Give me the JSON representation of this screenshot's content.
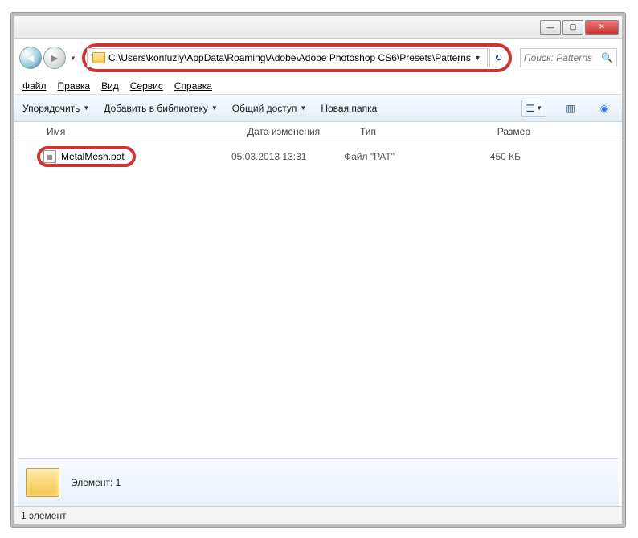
{
  "address": {
    "path": "C:\\Users\\konfuziy\\AppData\\Roaming\\Adobe\\Adobe Photoshop CS6\\Presets\\Patterns"
  },
  "search": {
    "placeholder": "Поиск: Patterns"
  },
  "menu": {
    "file": "Файл",
    "edit": "Правка",
    "view": "Вид",
    "tools": "Сервис",
    "help": "Справка"
  },
  "toolbar": {
    "organize": "Упорядочить",
    "addlib": "Добавить в библиотеку",
    "share": "Общий доступ",
    "newfolder": "Новая папка"
  },
  "columns": {
    "name": "Имя",
    "date": "Дата изменения",
    "type": "Тип",
    "size": "Размер"
  },
  "files": [
    {
      "name": "MetalMesh.pat",
      "date": "05.03.2013 13:31",
      "type": "Файл \"PAT\"",
      "size": "450 КБ"
    }
  ],
  "details": {
    "label": "Элемент: 1"
  },
  "status": {
    "text": "1 элемент"
  }
}
